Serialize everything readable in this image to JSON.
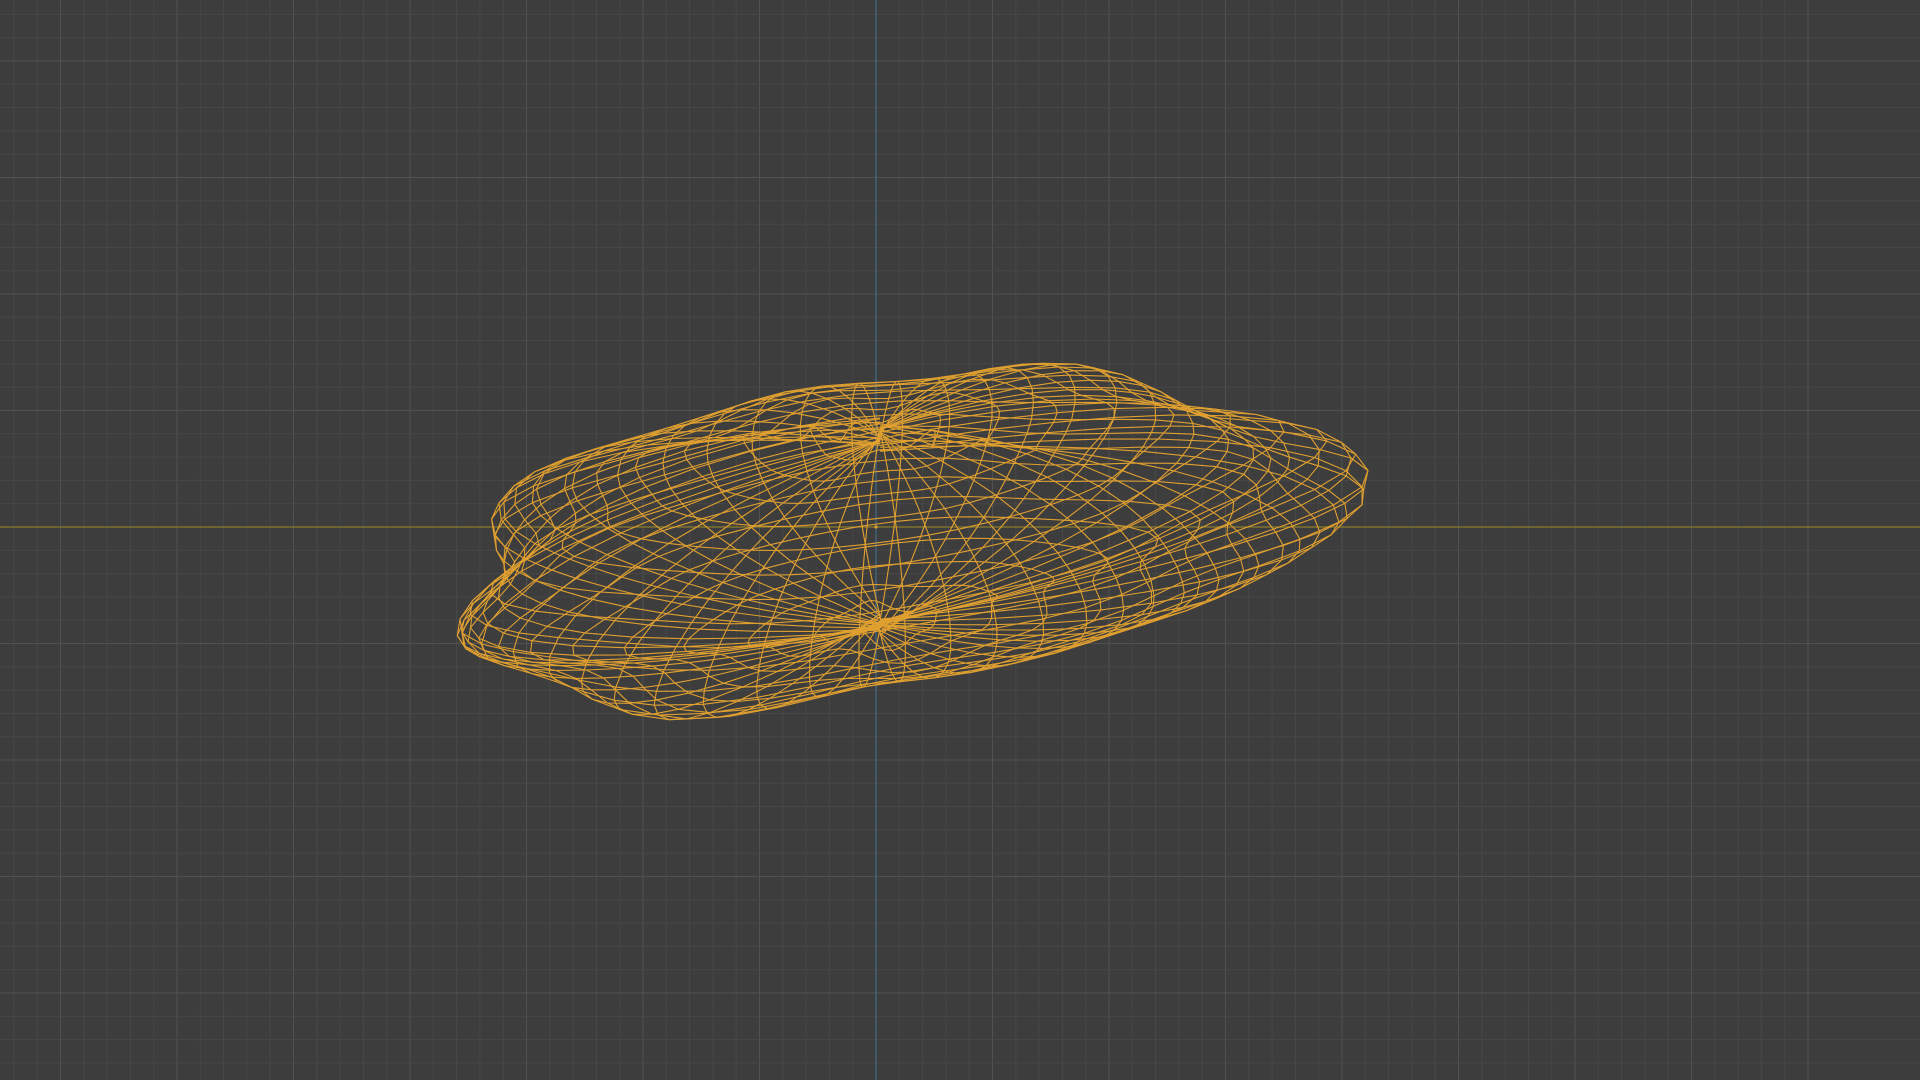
{
  "viewport": {
    "view": "3d-viewport-wireframe",
    "background_color": "#3d3d3d",
    "grid_minor_color": "#474747",
    "grid_major_color": "#515151",
    "axis_x_color": "#8a7c2c",
    "axis_y_color": "#3f6a8c",
    "mesh_wire_color": "#e0a030",
    "origin_marker_color": "#e0a030",
    "mesh_selected": true
  }
}
